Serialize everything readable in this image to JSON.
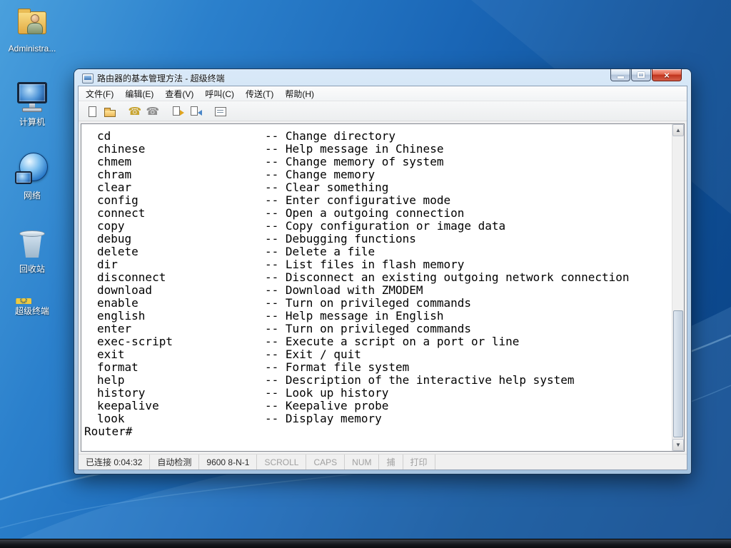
{
  "desktop": {
    "icons": [
      {
        "name": "administrator-folder",
        "type": "folder-user",
        "label": "Administra..."
      },
      {
        "name": "computer",
        "type": "computer",
        "label": "计算机"
      },
      {
        "name": "network",
        "type": "network",
        "label": "网络"
      },
      {
        "name": "recycle-bin",
        "type": "recycle",
        "label": "回收站"
      },
      {
        "name": "hyperterminal",
        "type": "terminal",
        "label": "超级终端"
      }
    ]
  },
  "window": {
    "title": "路由器的基本管理方法 - 超级终端",
    "menu": [
      {
        "name": "menu-file",
        "label": "文件(F)"
      },
      {
        "name": "menu-edit",
        "label": "编辑(E)"
      },
      {
        "name": "menu-view",
        "label": "查看(V)"
      },
      {
        "name": "menu-call",
        "label": "呼叫(C)"
      },
      {
        "name": "menu-transfer",
        "label": "传送(T)"
      },
      {
        "name": "menu-help",
        "label": "帮助(H)"
      }
    ],
    "toolbar": [
      {
        "key": "new",
        "name": "new-document-icon",
        "gap": false
      },
      {
        "key": "open",
        "name": "open-folder-icon",
        "gap": false
      },
      {
        "key": "call",
        "name": "call-icon",
        "glyph": "☎",
        "gap": true
      },
      {
        "key": "hangup",
        "name": "hangup-icon",
        "glyph": "☎",
        "gap": false
      },
      {
        "key": "send",
        "name": "send-file-icon",
        "gap": true
      },
      {
        "key": "receive",
        "name": "receive-file-icon",
        "gap": false
      },
      {
        "key": "props",
        "name": "properties-icon",
        "gap": true
      }
    ],
    "terminal": {
      "lines": [
        {
          "cmd": "cd",
          "desc": "-- Change directory"
        },
        {
          "cmd": "chinese",
          "desc": "-- Help message in Chinese"
        },
        {
          "cmd": "chmem",
          "desc": "-- Change memory of system"
        },
        {
          "cmd": "chram",
          "desc": "-- Change memory"
        },
        {
          "cmd": "clear",
          "desc": "-- Clear something"
        },
        {
          "cmd": "config",
          "desc": "-- Enter configurative mode"
        },
        {
          "cmd": "connect",
          "desc": "-- Open a outgoing connection"
        },
        {
          "cmd": "copy",
          "desc": "-- Copy configuration or image data"
        },
        {
          "cmd": "debug",
          "desc": "-- Debugging functions"
        },
        {
          "cmd": "delete",
          "desc": "-- Delete a file"
        },
        {
          "cmd": "dir",
          "desc": "-- List files in flash memory"
        },
        {
          "cmd": "disconnect",
          "desc": "-- Disconnect an existing outgoing network connection"
        },
        {
          "cmd": "download",
          "desc": "-- Download with ZMODEM"
        },
        {
          "cmd": "enable",
          "desc": "-- Turn on privileged commands"
        },
        {
          "cmd": "english",
          "desc": "-- Help message in English"
        },
        {
          "cmd": "enter",
          "desc": "-- Turn on privileged commands"
        },
        {
          "cmd": "exec-script",
          "desc": "-- Execute a script on a port or line"
        },
        {
          "cmd": "exit",
          "desc": "-- Exit / quit"
        },
        {
          "cmd": "format",
          "desc": "-- Format file system"
        },
        {
          "cmd": "help",
          "desc": "-- Description of the interactive help system"
        },
        {
          "cmd": "history",
          "desc": "-- Look up history"
        },
        {
          "cmd": "keepalive",
          "desc": "-- Keepalive probe"
        },
        {
          "cmd": "look",
          "desc": "-- Display memory"
        }
      ],
      "prompt": "Router#"
    },
    "status": [
      {
        "name": "connection-status",
        "label": "已连接 0:04:32",
        "enabled": true
      },
      {
        "name": "detect-mode",
        "label": "自动检测",
        "enabled": true
      },
      {
        "name": "baud-rate",
        "label": "9600 8-N-1",
        "enabled": true
      },
      {
        "name": "scroll-indicator",
        "label": "SCROLL",
        "enabled": false
      },
      {
        "name": "caps-indicator",
        "label": "CAPS",
        "enabled": false
      },
      {
        "name": "num-indicator",
        "label": "NUM",
        "enabled": false
      },
      {
        "name": "capture-indicator",
        "label": "捕",
        "enabled": false
      },
      {
        "name": "print-indicator",
        "label": "打印",
        "enabled": false
      }
    ]
  }
}
